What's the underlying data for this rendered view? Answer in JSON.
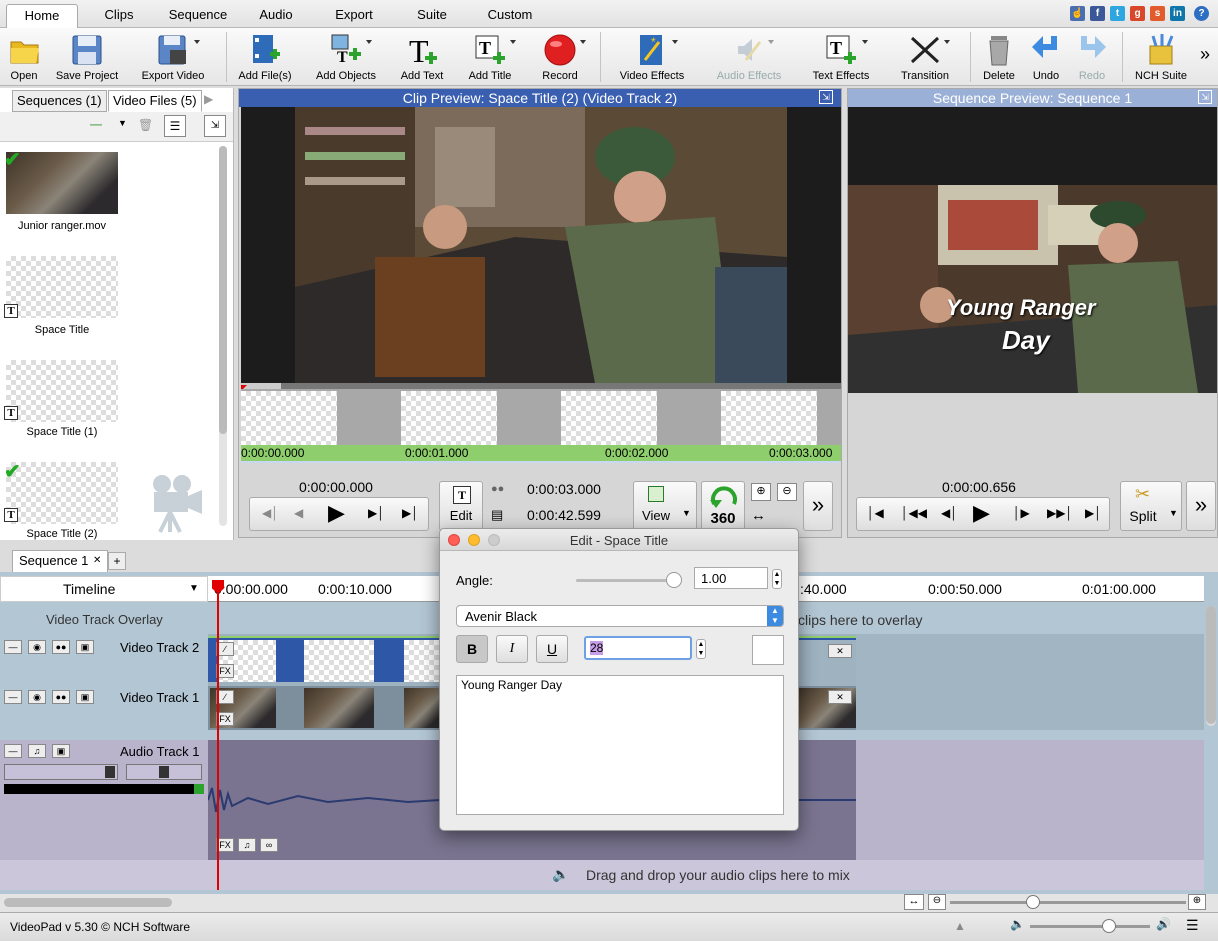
{
  "menu": {
    "tabs": [
      "Home",
      "Clips",
      "Sequence",
      "Audio",
      "Export",
      "Suite",
      "Custom"
    ],
    "active_tab": "Home",
    "social_icons": [
      "thumbs-up-icon",
      "facebook-icon",
      "twitter-icon",
      "google-plus-icon",
      "stumbleupon-icon",
      "linkedin-icon",
      "help-icon"
    ]
  },
  "toolbar": {
    "open": "Open",
    "save_project": "Save Project",
    "export_video": "Export Video",
    "add_files": "Add File(s)",
    "add_objects": "Add Objects",
    "add_text": "Add Text",
    "add_title": "Add Title",
    "record": "Record",
    "video_effects": "Video Effects",
    "audio_effects": "Audio Effects",
    "text_effects": "Text Effects",
    "transition": "Transition",
    "delete": "Delete",
    "undo": "Undo",
    "redo": "Redo",
    "nch_suite": "NCH Suite"
  },
  "bins": {
    "tab_sequences": "Sequences (1)",
    "tab_video_files": "Video Files (5)",
    "items": [
      {
        "label": "Junior ranger.mov",
        "checked": true
      },
      {
        "label": "Space Title",
        "checked": false
      },
      {
        "label": "Space Title (1)",
        "checked": false
      },
      {
        "label": "Space Title (2)",
        "checked": true
      }
    ]
  },
  "clip_preview": {
    "title": "Clip Preview: Space Title (2) (Video Track 2)",
    "ruler": [
      "0:00:00.000",
      "0:00:01.000",
      "0:00:02.000",
      "0:00:03.000"
    ],
    "position": "0:00:00.000",
    "duration": "0:00:03.000",
    "total": "0:00:42.599",
    "edit_label": "Edit",
    "view_label": "View",
    "degrees_label": "360"
  },
  "sequence_preview": {
    "title": "Sequence Preview: Sequence 1",
    "overlay_line1": "Young Ranger",
    "overlay_line2": "Day",
    "position": "0:00:00.656",
    "split_label": "Split"
  },
  "timeline": {
    "sequence_tab": "Sequence 1",
    "add_tab": "+",
    "mode_label": "Timeline",
    "ruler": [
      "0:00:00.000",
      "0:00:10.000",
      ":40.000",
      "0:00:50.000",
      "0:01:00.000"
    ],
    "overlay_label": "Video Track Overlay",
    "overlay_hint": "clips here to overlay",
    "video_track_2": "Video Track 2",
    "video_track_1": "Video Track 1",
    "audio_track_1": "Audio Track 1",
    "audio_hint": "Drag and drop your audio clips here to mix"
  },
  "dialog": {
    "title": "Edit - Space Title",
    "angle_label": "Angle:",
    "angle_value": "1.00",
    "font": "Avenir Black",
    "bold": "B",
    "italic": "I",
    "underline": "U",
    "size_value": "28",
    "text": "Young Ranger Day"
  },
  "status": {
    "version": "VideoPad v 5.30 © NCH Software"
  },
  "colors": {
    "accent_blue": "#3a5fb0",
    "track_blue": "#2f57a8",
    "ruler_green": "#8fce6c",
    "audio_track": "#b9b3cc"
  }
}
